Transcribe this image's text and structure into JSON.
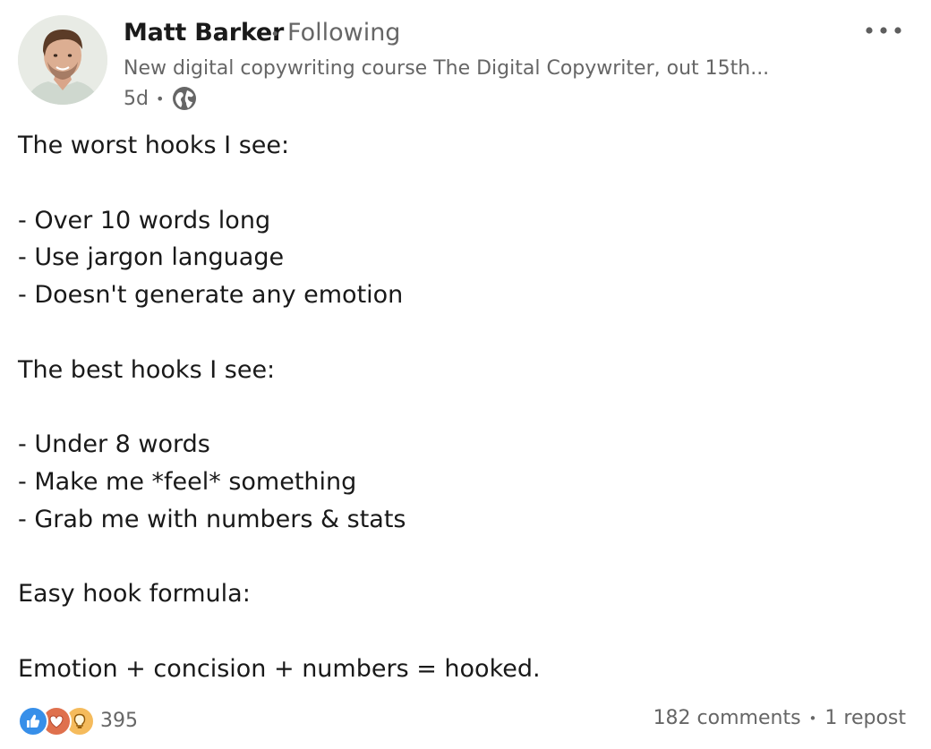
{
  "author": {
    "name": "Matt Barker",
    "follow_status": "Following",
    "headline": "New digital copywriting course The Digital Copywriter, out 15th...",
    "age": "5d",
    "visibility_icon": "globe-icon"
  },
  "menu": {
    "icon": "more-horizontal-icon"
  },
  "body": {
    "lines": [
      "The worst hooks I see:",
      "",
      "- Over 10 words long",
      "- Use jargon language",
      "- Doesn't generate any emotion",
      "",
      "The best hooks I see:",
      "",
      "- Under 8 words",
      "- Make me *feel* something",
      "- Grab me with numbers & stats",
      "",
      "Easy hook formula:",
      "",
      "Emotion + concision + numbers = hooked."
    ]
  },
  "social": {
    "reaction_icons": [
      "like-icon",
      "love-icon",
      "insightful-icon"
    ],
    "reaction_count": "395",
    "comments": "182 comments",
    "reposts": "1 repost"
  },
  "colors": {
    "like": "#378fe9",
    "love": "#df704d",
    "insightful": "#f5bb5c",
    "secondary_text": "#666666"
  }
}
